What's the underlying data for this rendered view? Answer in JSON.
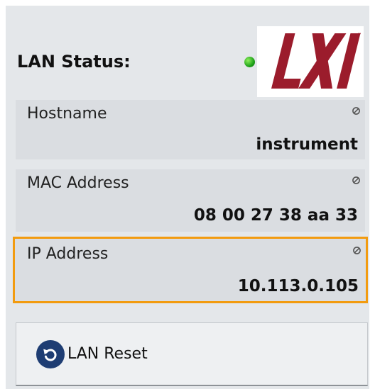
{
  "lan_status": {
    "label": "LAN Status:",
    "indicator": "green",
    "logo_text": "LXI"
  },
  "fields": [
    {
      "label": "Hostname",
      "value": "instrument",
      "icon": "lock-icon"
    },
    {
      "label": "MAC Address",
      "value": "08 00 27 38 aa 33",
      "icon": "lock-icon"
    },
    {
      "label": "IP Address",
      "value": "10.113.0.105",
      "icon": "lock-icon"
    }
  ],
  "reset_button": {
    "label": "LAN Reset",
    "icon": "reset-icon"
  },
  "colors": {
    "panel_background": "#e4e7ea",
    "field_background": "#dadde1",
    "focus_border": "#f29b0f",
    "status_led": "#2bb324",
    "logo_red": "#9b1c2c",
    "reset_icon_background": "#1e3d73"
  }
}
